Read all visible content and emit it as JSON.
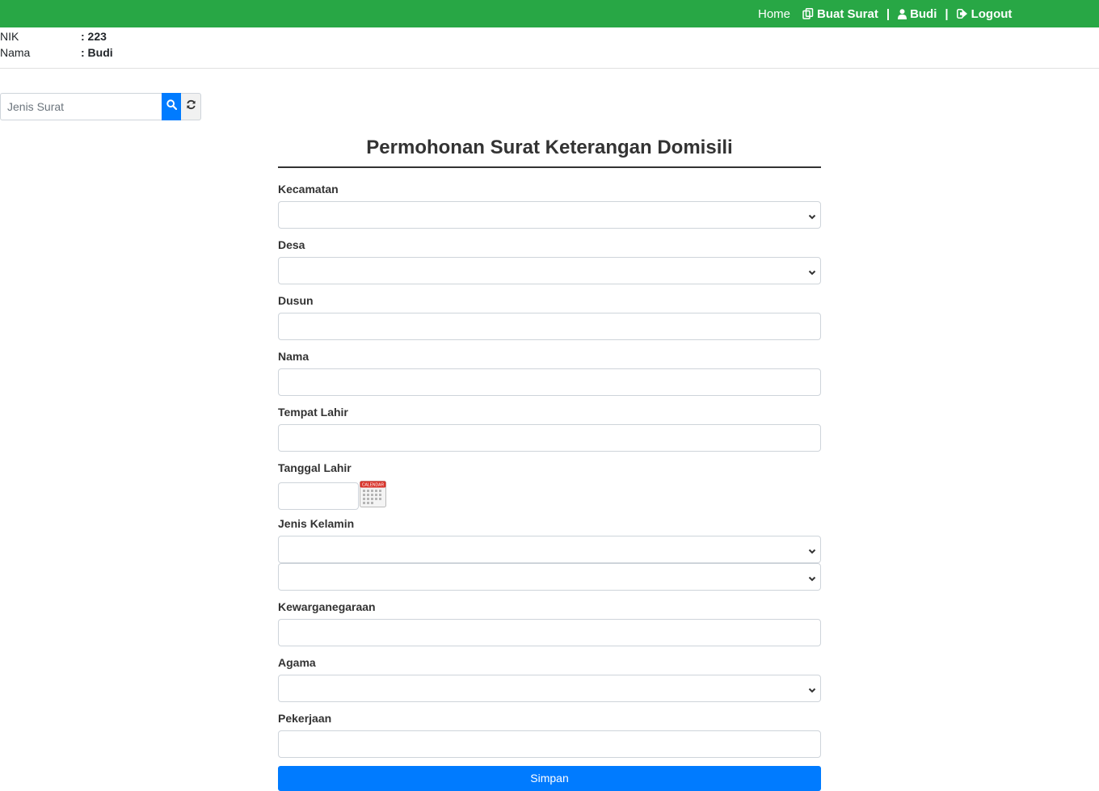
{
  "nav": {
    "home": "Home",
    "buat_surat": "Buat Surat",
    "user": "Budi",
    "logout": "Logout",
    "separator": "|",
    "bg_color": "#28a745"
  },
  "userinfo": {
    "nik_label": "NIK",
    "nik_value": ": 223",
    "nama_label": "Nama",
    "nama_value": ": Budi"
  },
  "search": {
    "placeholder": "Jenis Surat"
  },
  "form": {
    "title": "Permohonan Surat Keterangan Domisili",
    "kecamatan": "Kecamatan",
    "desa": "Desa",
    "dusun": "Dusun",
    "nama": "Nama",
    "tempat_lahir": "Tempat Lahir",
    "tanggal_lahir": "Tanggal Lahir",
    "calendar_text": "CALENDAR",
    "jenis_kelamin": "Jenis Kelamin",
    "kewarganegaraan": "Kewarganegaraan",
    "agama": "Agama",
    "pekerjaan": "Pekerjaan",
    "submit": "Simpan",
    "submit_color": "#007bff"
  }
}
